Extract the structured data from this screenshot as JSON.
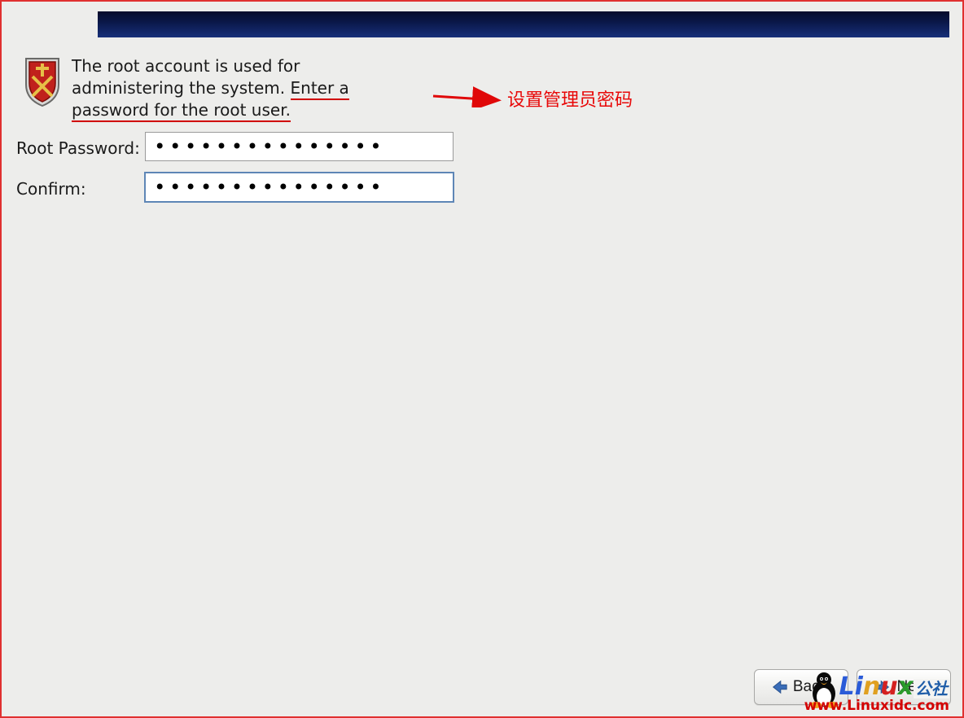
{
  "intro": {
    "text_plain": "The root account is used for administering the system.  ",
    "text_underlined": "Enter a password for the root user."
  },
  "annotation": {
    "text": "设置管理员密码"
  },
  "form": {
    "root_password_label": "Root Password:",
    "confirm_label": "Confirm:",
    "root_password_value": "•••••••••••••••",
    "confirm_value": "•••••••••••••••"
  },
  "nav": {
    "back_label": "Back",
    "next_label": "Next"
  },
  "watermark": {
    "brand_li": "Li",
    "brand_n": "n",
    "brand_u": "u",
    "brand_x": "x",
    "brand_cn": "公社",
    "url": "www.Linuxidc.com"
  }
}
